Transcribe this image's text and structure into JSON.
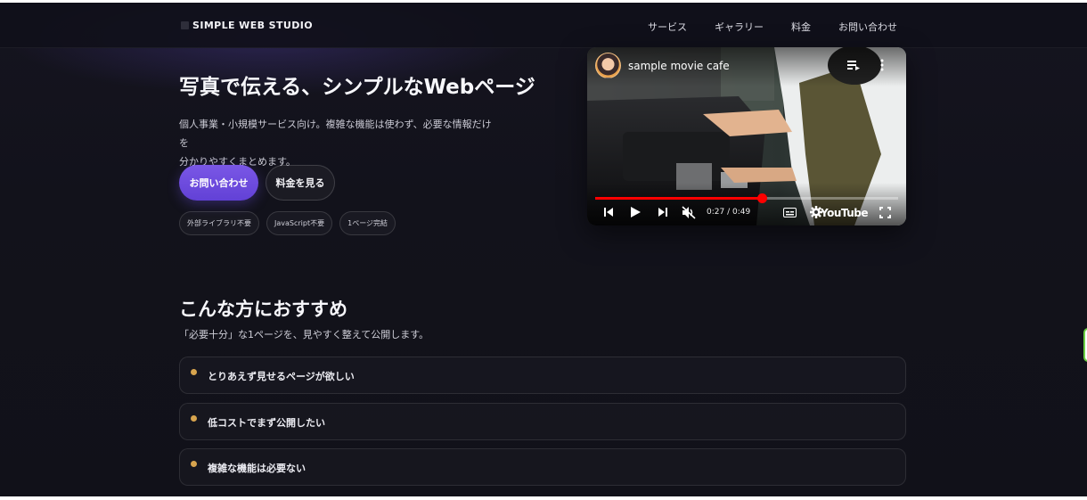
{
  "header": {
    "brand": "SIMPLE WEB STUDIO",
    "nav": [
      "サービス",
      "ギャラリー",
      "料金",
      "お問い合わせ"
    ]
  },
  "hero": {
    "title": "写真で伝える、シンプルなWebページ",
    "desc_line1": "個人事業・小規模サービス向け。複雑な機能は使わず、必要な情報だけを",
    "desc_line2": "分かりやすくまとめます。",
    "primary_button": "お問い合わせ",
    "secondary_button": "料金を見る",
    "tags": [
      "外部ライブラリ不要",
      "JavaScript不要",
      "1ページ完結"
    ]
  },
  "video": {
    "title": "sample movie cafe",
    "time": "0:27 / 0:49",
    "progress": 0.551,
    "logo": "YouTube",
    "icons": [
      "avatar",
      "playlist-icon",
      "more-icon",
      "previous-icon",
      "play-icon",
      "next-icon",
      "mute-icon",
      "subtitles-icon",
      "settings-icon",
      "fullscreen-icon"
    ]
  },
  "recommend": {
    "title": "こんな方におすすめ",
    "subtitle": "「必要十分」な1ページを、見やすく整えて公開します。",
    "items": [
      "とりあえず見せるページが欲しい",
      "低コストでまず公開したい",
      "複雑な機能は必要ない"
    ]
  },
  "colors": {
    "accent": "#6a4be0",
    "bullet": "#d7a44e",
    "progress": "#ff0000",
    "background": "#12121b"
  }
}
